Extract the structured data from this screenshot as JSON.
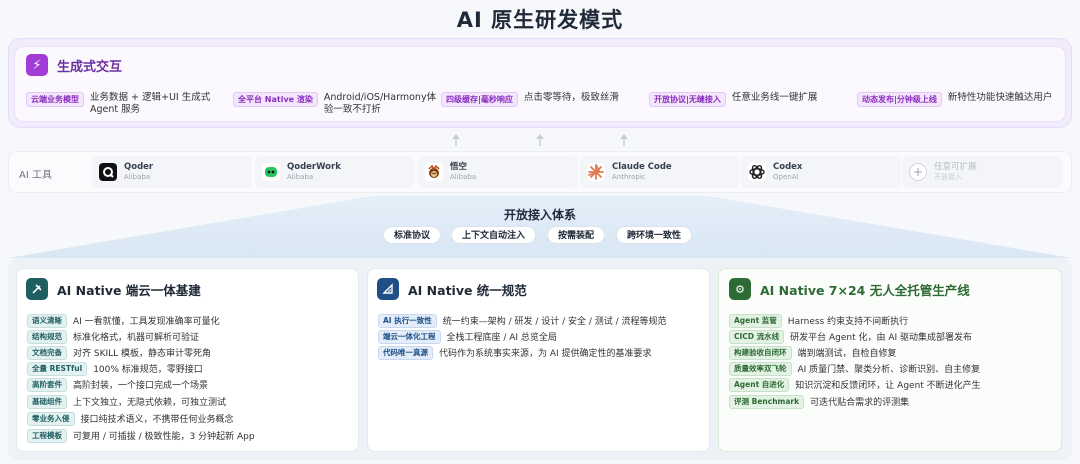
{
  "title": "AI 原生研发模式",
  "generative": {
    "title": "生成式交互",
    "items": [
      {
        "badge": "云端业务模型",
        "text": "业务数据 + 逻辑+UI 生成式\nAgent 服务"
      },
      {
        "badge": "全平台 Native 渲染",
        "text": "Android/iOS/Harmony体\n验一致不打折"
      },
      {
        "badge": "四级缓存|毫秒响应",
        "text": "点击零等待，极致丝滑"
      },
      {
        "badge": "开放协议|无缝接入",
        "text": "任意业务线一键扩展"
      },
      {
        "badge": "动态发布|分钟级上线",
        "text": "新特性功能快速触达用户"
      }
    ]
  },
  "tools": {
    "label": "AI 工具",
    "items": [
      {
        "name": "Qoder",
        "sub": "Alibaba",
        "icon": "qoder-icon",
        "color": "#111111"
      },
      {
        "name": "QoderWork",
        "sub": "Alibaba",
        "icon": "qoderwork-icon",
        "color": "#22c55e"
      },
      {
        "name": "悟空",
        "sub": "Alibaba",
        "icon": "wukong-icon",
        "color": "#b45309"
      },
      {
        "name": "Claude Code",
        "sub": "Anthropic",
        "icon": "claude-icon",
        "color": "#e07a4f"
      },
      {
        "name": "Codex",
        "sub": "OpenAI",
        "icon": "openai-icon",
        "color": "#222222"
      },
      {
        "name": "任意可扩展",
        "sub": "开放接入",
        "icon": "plus-icon",
        "color": "#d1d5db"
      }
    ]
  },
  "open_access": {
    "title": "开放接入体系",
    "pills": [
      "标准协议",
      "上下文自动注入",
      "按需装配",
      "跨环境一致性"
    ]
  },
  "cards": [
    {
      "title": "AI Native 端云一体基建",
      "color": "#1f5f62",
      "rows": [
        {
          "badge": "语义清晰",
          "text": "AI 一看就懂，工具发现准确率可量化"
        },
        {
          "badge": "结构规范",
          "text": "标准化格式，机器可解析可验证"
        },
        {
          "badge": "文档完备",
          "text": "对齐 SKILL 模板，静态审计零死角"
        },
        {
          "badge": "全量 RESTful",
          "text": "100% 标准规范，零野接口"
        },
        {
          "badge": "高阶套件",
          "text": "高阶封装，一个接口完成一个场景"
        },
        {
          "badge": "基础组件",
          "text": "上下文独立，无隐式依赖，可独立测试"
        },
        {
          "badge": "零业务入侵",
          "text": "接口纯技术语义，不携带任何业务概念"
        },
        {
          "badge": "工程模板",
          "text": "可复用 / 可插拔 / 极致性能，3 分钟起新 App"
        }
      ]
    },
    {
      "title": "AI Native 统一规范",
      "color": "#1f4f86",
      "rows": [
        {
          "badge": "AI 执行一致性",
          "text": "统一约束—架构 / 研发 / 设计 / 安全 / 测试 / 流程等规范"
        },
        {
          "badge": "端云一体化工程",
          "text": "全栈工程底座 / AI 总览全局"
        },
        {
          "badge": "代码唯一真源",
          "text": "代码作为系统事实来源，为 AI 提供确定性的基准要求"
        }
      ]
    },
    {
      "title": "AI Native 7×24 无人全托管生产线",
      "color": "#2e6b34",
      "rows": [
        {
          "badge": "Agent 监管",
          "text": "Harness 约束支持不间断执行"
        },
        {
          "badge": "CICD 流水线",
          "text": "研发平台 Agent 化，由 AI 驱动集成部署发布"
        },
        {
          "badge": "构建验收自闭环",
          "text": "端到端测试，自检自修复"
        },
        {
          "badge": "质量效率双飞轮",
          "text": "AI 质量门禁、聚类分析、诊断识别、自主修复"
        },
        {
          "badge": "Agent 自进化",
          "text": "知识沉淀和反馈闭环，让 Agent 不断进化产生"
        },
        {
          "badge": "评测 Benchmark",
          "text": "可迭代贴合需求的评测集"
        }
      ]
    }
  ]
}
